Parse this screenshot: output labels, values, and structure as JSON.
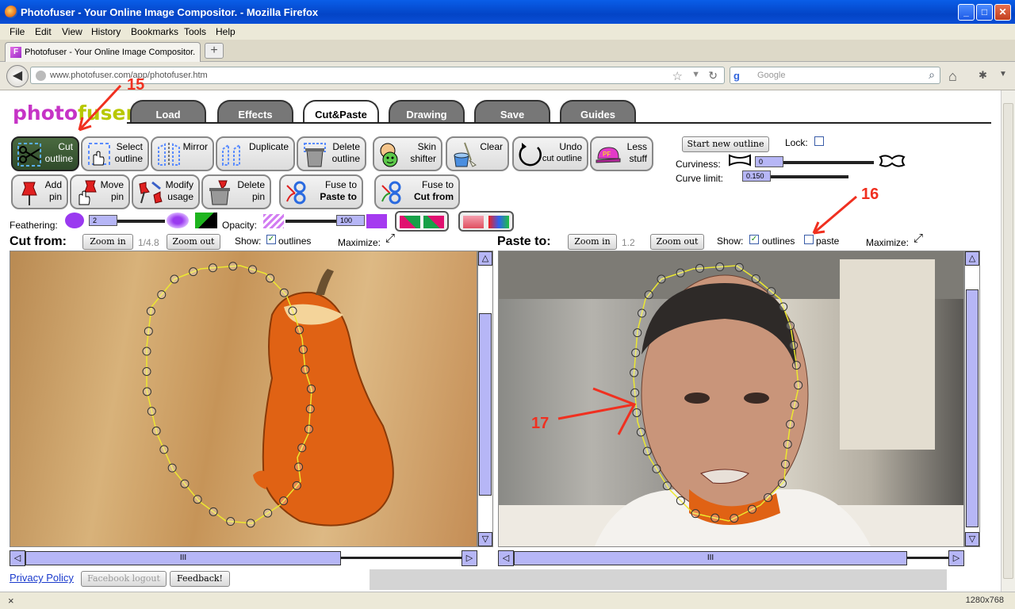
{
  "window": {
    "title": "Photofuser - Your Online Image Compositor. - Mozilla Firefox"
  },
  "menu": [
    "File",
    "Edit",
    "View",
    "History",
    "Bookmarks",
    "Tools",
    "Help"
  ],
  "browser_tab": {
    "title": "Photofuser - Your Online Image Compositor.",
    "favicon": "F"
  },
  "address": {
    "url": "www.photofuser.com/app/photofuser.htm"
  },
  "search": {
    "placeholder": "Google",
    "engine": "g"
  },
  "logo": {
    "part1": "photo",
    "part2": "fuser"
  },
  "app_tabs": [
    {
      "label": "Load",
      "active": false
    },
    {
      "label": "Effects",
      "active": false
    },
    {
      "label": "Cut&Paste",
      "active": true
    },
    {
      "label": "Drawing",
      "active": false
    },
    {
      "label": "Save",
      "active": false
    },
    {
      "label": "Guides",
      "active": false
    }
  ],
  "tools_row1": [
    {
      "line1": "Cut",
      "line2": "outline",
      "active": true
    },
    {
      "line1": "Select",
      "line2": "outline"
    },
    {
      "line1": "Mirror",
      "line2": ""
    },
    {
      "line1": "Duplicate",
      "line2": ""
    },
    {
      "line1": "Delete",
      "line2": "outline"
    },
    {
      "line1": "Skin",
      "line2": "shifter"
    },
    {
      "line1": "Clear",
      "line2": ""
    },
    {
      "line1": "Undo",
      "line2": "cut outline"
    },
    {
      "line1": "Less",
      "line2": "stuff"
    }
  ],
  "tools_row2": [
    {
      "line1": "Add",
      "line2": "pin"
    },
    {
      "line1": "Move",
      "line2": "pin"
    },
    {
      "line1": "Modify",
      "line2": "usage"
    },
    {
      "line1": "Delete",
      "line2": "pin"
    },
    {
      "line1": "Fuse to",
      "line2": "Paste to"
    },
    {
      "line1": "Fuse to",
      "line2": "Cut from"
    }
  ],
  "outline_controls": {
    "start_button": "Start new outline",
    "lock_label": "Lock:",
    "curviness_label": "Curviness:",
    "curviness_value": "0",
    "curve_limit_label": "Curve limit:",
    "curve_limit_value": "0.150"
  },
  "feathering": {
    "label": "Feathering:",
    "value": "2"
  },
  "opacity": {
    "label": "Opacity:",
    "value": "100"
  },
  "cut_panel": {
    "title": "Cut from:",
    "zoom_in": "Zoom in",
    "zoom_level": "1/4.8",
    "zoom_out": "Zoom out",
    "show_label": "Show:",
    "outlines_label": "outlines",
    "maximize_label": "Maximize:"
  },
  "paste_panel": {
    "title": "Paste to:",
    "zoom_in": "Zoom in",
    "zoom_level": "1.2",
    "zoom_out": "Zoom out",
    "show_label": "Show:",
    "outlines_label": "outlines",
    "paste_label": "paste",
    "maximize_label": "Maximize:"
  },
  "footer": {
    "privacy": "Privacy Policy",
    "facebook": "Facebook logout",
    "feedback": "Feedback!"
  },
  "annotations": {
    "a15": "15",
    "a16": "16",
    "a17": "17"
  },
  "statusbar": {
    "close": "×",
    "resolution": "1280x768"
  },
  "colors": {
    "accent": "#b6b6f6",
    "annotation": "#f03020",
    "active_tool": "#2f4a2a"
  }
}
